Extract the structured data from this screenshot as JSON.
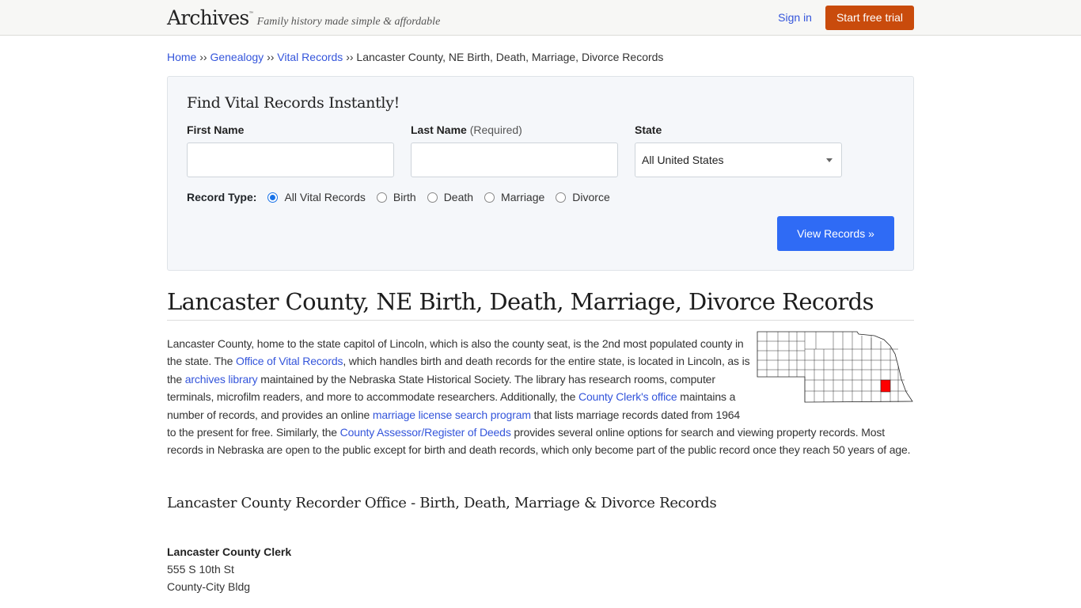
{
  "header": {
    "logo": "Archives",
    "logo_tm": "™",
    "tagline": "Family history made simple & affordable",
    "signin_label": "Sign in",
    "trial_label": "Start free trial",
    "trial_color": "#c94b0c"
  },
  "breadcrumb": {
    "items": [
      {
        "label": "Home",
        "link": true
      },
      {
        "label": "Genealogy",
        "link": true
      },
      {
        "label": "Vital Records",
        "link": true
      },
      {
        "label": "Lancaster County, NE Birth, Death, Marriage, Divorce Records",
        "link": false
      }
    ],
    "separator": "››"
  },
  "search": {
    "title": "Find Vital Records Instantly!",
    "first_name_label": "First Name",
    "first_name_value": "",
    "last_name_label": "Last Name",
    "last_name_hint": "(Required)",
    "last_name_value": "",
    "state_label": "State",
    "state_selected": "All United States",
    "record_type_label": "Record Type:",
    "record_types": [
      {
        "label": "All Vital Records",
        "checked": true
      },
      {
        "label": "Birth",
        "checked": false
      },
      {
        "label": "Death",
        "checked": false
      },
      {
        "label": "Marriage",
        "checked": false
      },
      {
        "label": "Divorce",
        "checked": false
      }
    ],
    "submit_label": "View Records »",
    "submit_color": "#2f6bf5"
  },
  "main": {
    "title": "Lancaster County, NE Birth, Death, Marriage, Divorce Records",
    "map_icon": "nebraska-county-map",
    "map_highlight_color": "#ff0000",
    "intro": {
      "t1": "Lancaster County, home to the state capitol of Lincoln, which is also the county seat, is the 2nd most populated county in the state. The ",
      "l1": "Office of Vital Records",
      "t2": ", which handles birth and death records for the entire state, is located in Lincoln, as is the ",
      "l2": "archives library",
      "t3": " maintained by the Nebraska State Historical Society. The library has research rooms, computer terminals, microfilm readers, and more to accommodate researchers. Additionally, the ",
      "l3": "County Clerk's office",
      "t4": " maintains a number of records, and provides an online ",
      "l4": "marriage license search program",
      "t5": " that lists marriage records dated from 1964 to the present for free. Similarly, the ",
      "l5": "County Assessor/Register of Deeds",
      "t6": " provides several online options for search and viewing property records. Most records in Nebraska are open to the public except for birth and death records, which only become part of the public record once they reach 50 years of age."
    },
    "section_title": "Lancaster County Recorder Office - Birth, Death, Marriage & Divorce Records",
    "office": {
      "name": "Lancaster County Clerk",
      "address1": "555 S 10th St",
      "address2": "County-City Bldg"
    }
  }
}
